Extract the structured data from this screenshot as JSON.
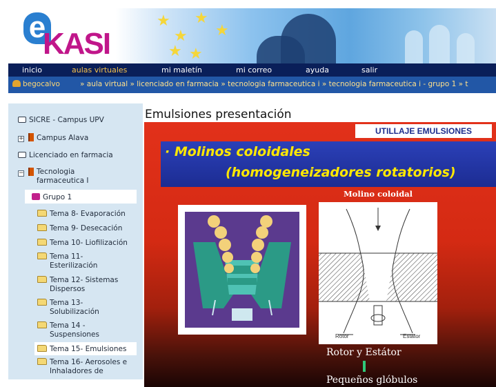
{
  "banner": {
    "logo_e": "e",
    "logo_text": "KASI"
  },
  "topnav": {
    "items": [
      {
        "label": "inicio"
      },
      {
        "label": "aulas virtuales",
        "active": true
      },
      {
        "label": "mi maletín"
      },
      {
        "label": "mi correo"
      },
      {
        "label": "ayuda"
      },
      {
        "label": "salir"
      }
    ]
  },
  "breadcrumb": {
    "user": "begocalvo",
    "path": "» aula virtual » licenciado en farmacia » tecnologia farmaceutica i » tecnologia farmaceutica i - grupo 1 » t"
  },
  "sidebar": {
    "items": [
      {
        "label": "SICRE - Campus UPV"
      },
      {
        "label": "Campus Alava",
        "toggle": "+"
      },
      {
        "label": "Licenciado en farmacia"
      },
      {
        "label": "Tecnologia farmaceutica I",
        "toggle": "−"
      },
      {
        "label": "Grupo 1"
      },
      {
        "label": "Tema 8- Evaporación"
      },
      {
        "label": "Tema 9- Desecación"
      },
      {
        "label": "Tema 10- Liofilización"
      },
      {
        "label": "Tema 11- Esterilización"
      },
      {
        "label": "Tema 12- Sistemas Dispersos"
      },
      {
        "label": "Tema 13- Solubilización"
      },
      {
        "label": "Tema 14 - Suspensiones"
      },
      {
        "label": "Tema 15- Emulsiones"
      },
      {
        "label": "Tema 16- Aerosoles e Inhaladores de"
      }
    ]
  },
  "main": {
    "title": "Emulsiones presentación",
    "slide": {
      "tag": "UTILLAJE EMULSIONES",
      "heading_line1": "· Molinos coloidales",
      "heading_line2": "(homogeneizadores rotatorios)",
      "right_image_title": "Molino coloidal",
      "rotor_label": "Rotor",
      "estator_label": "Estator",
      "caption1": "Rotor y Estátor",
      "caption2": "Pequeños glóbulos"
    }
  },
  "colors": {
    "nav_bg": "#0a1f59",
    "breadcrumb_bg": "#2257a6",
    "sidebar_bg": "#d6e6f2",
    "slide_red": "#e2311a",
    "slide_heading_blue": "#2b40b8",
    "slide_heading_text": "#ffe800"
  }
}
